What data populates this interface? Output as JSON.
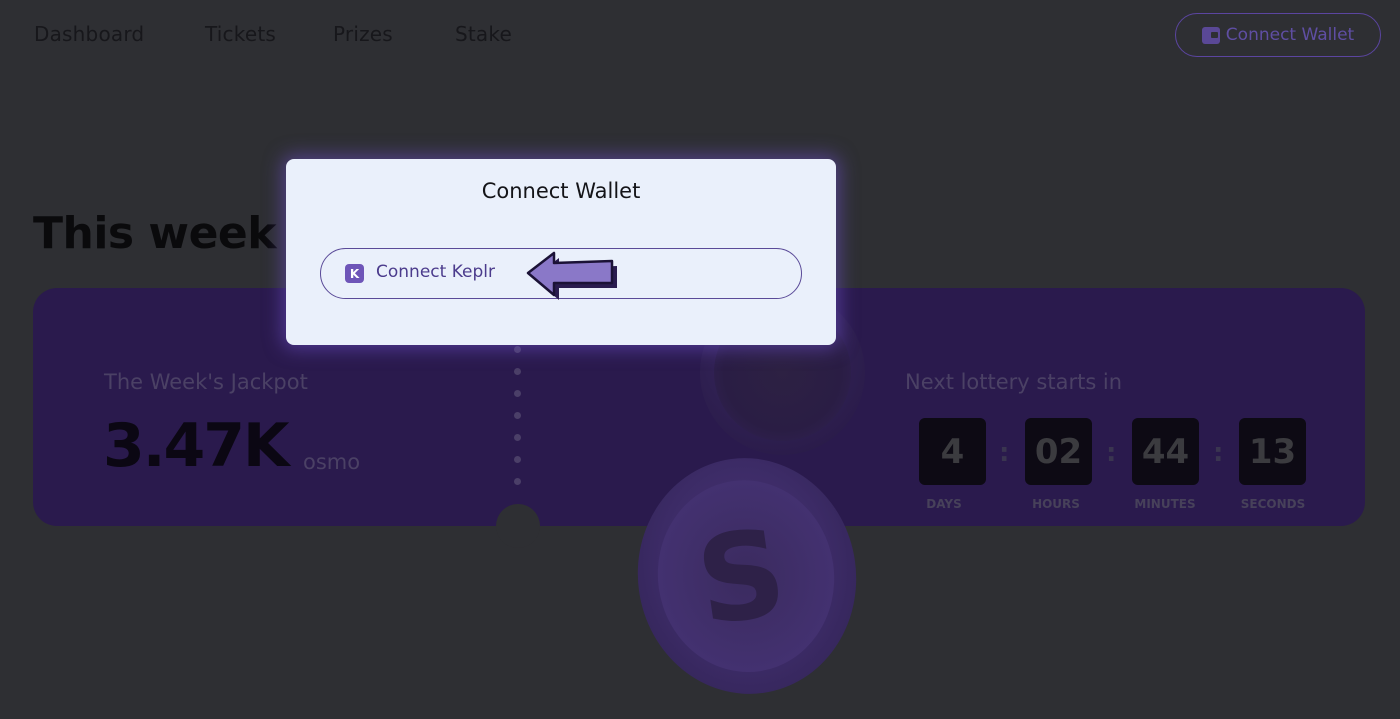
{
  "nav": {
    "items": [
      "Dashboard",
      "Tickets",
      "Prizes",
      "Stake"
    ],
    "connect_button": "Connect Wallet"
  },
  "section": {
    "title": "This week"
  },
  "jackpot": {
    "label": "The Week's Jackpot",
    "value": "3.47K",
    "unit": "osmo"
  },
  "countdown": {
    "label": "Next lottery starts in",
    "units": [
      {
        "value": "4",
        "caption": "DAYS"
      },
      {
        "value": "02",
        "caption": "HOURS"
      },
      {
        "value": "44",
        "caption": "MINUTES"
      },
      {
        "value": "13",
        "caption": "SECONDS"
      }
    ],
    "separator": ":"
  },
  "modal": {
    "title": "Connect Wallet",
    "option_label": "Connect Keplr",
    "option_icon_letter": "K"
  },
  "colors": {
    "accent": "#5b45a0",
    "card": "#2a1a4d",
    "modal_bg": "#eaf0fb",
    "backdrop": "#2e2f33"
  },
  "icons": {
    "wallet": "wallet-icon",
    "keplr": "keplr-logo-icon",
    "pointer": "arrow-pointer-icon"
  }
}
